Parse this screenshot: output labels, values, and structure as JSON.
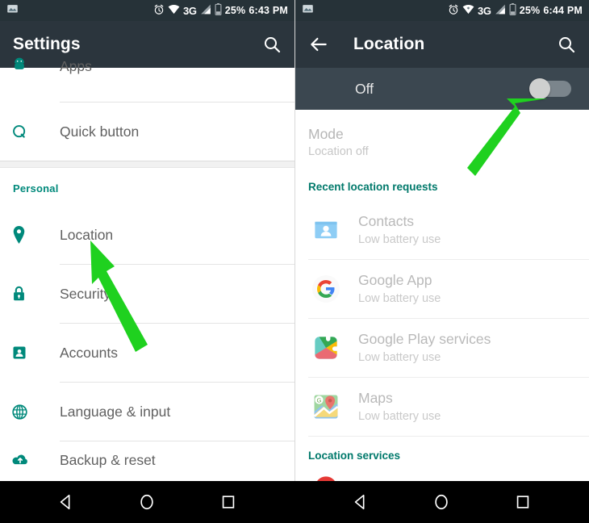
{
  "left_panel": {
    "status_bar": {
      "screenshot_icon": "image-icon",
      "alarm_icon": "alarm-clock-icon",
      "wifi_icon": "wifi-icon",
      "network_type": "3G",
      "signal_icon": "signal-bars-icon",
      "battery_icon": "battery-icon",
      "battery_percent": "25%",
      "time": "6:43 PM"
    },
    "appbar": {
      "title": "Settings",
      "search_icon": "search-icon"
    },
    "items": [
      {
        "label": "Apps",
        "icon": "android-robot-icon"
      },
      {
        "label": "Quick button",
        "icon": "quick-button-icon"
      }
    ],
    "section": {
      "header": "Personal",
      "items": [
        {
          "label": "Location",
          "icon": "location-pin-icon"
        },
        {
          "label": "Security",
          "icon": "lock-icon"
        },
        {
          "label": "Accounts",
          "icon": "account-person-icon"
        },
        {
          "label": "Language & input",
          "icon": "globe-icon"
        },
        {
          "label": "Backup & reset",
          "icon": "cloud-upload-icon"
        }
      ]
    }
  },
  "right_panel": {
    "status_bar": {
      "screenshot_icon": "image-icon",
      "alarm_icon": "alarm-clock-icon",
      "wifi_icon": "wifi-icon",
      "network_type": "3G",
      "signal_icon": "signal-bars-icon",
      "battery_icon": "battery-icon",
      "battery_percent": "25%",
      "time": "6:44 PM"
    },
    "appbar": {
      "back_icon": "back-arrow-icon",
      "title": "Location",
      "search_icon": "search-icon"
    },
    "master_switch": {
      "label": "Off",
      "state": "off",
      "knob_color": "#cfd0cf",
      "track_color": "#7b858c"
    },
    "mode": {
      "title": "Mode",
      "subtitle": "Location off"
    },
    "recent_requests": {
      "header": "Recent location requests",
      "items": [
        {
          "title": "Contacts",
          "subtitle": "Low battery use",
          "icon": "contacts-app-icon"
        },
        {
          "title": "Google App",
          "subtitle": "Low battery use",
          "icon": "google-app-icon"
        },
        {
          "title": "Google Play services",
          "subtitle": "Low battery use",
          "icon": "google-play-services-icon"
        },
        {
          "title": "Maps",
          "subtitle": "Low battery use",
          "icon": "google-maps-icon"
        }
      ]
    },
    "location_services": {
      "header": "Location services",
      "partial_item_icon": "red-app-icon"
    }
  },
  "nav_bar": {
    "back": "back-triangle-icon",
    "home": "home-circle-icon",
    "recents": "recents-square-icon"
  },
  "annotations": {
    "arrow_color": "#1fd11f",
    "left_arrow_target": "Location",
    "right_arrow_target": "location-master-switch"
  },
  "theme": {
    "accent_teal": "#00897b",
    "appbar_bg": "#2b353d",
    "statusbar_bg": "#263238",
    "switch_row_bg": "#3b4750"
  }
}
